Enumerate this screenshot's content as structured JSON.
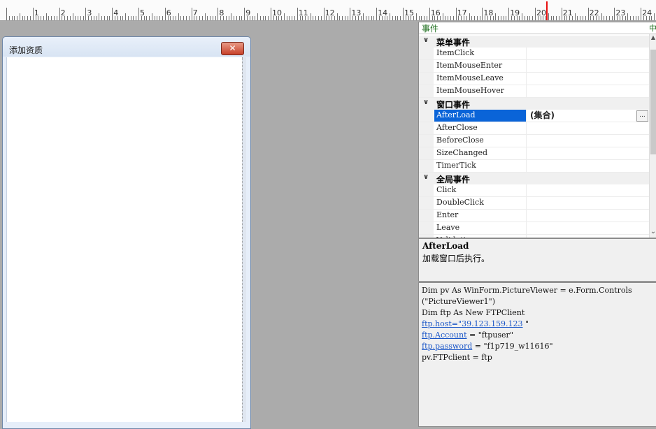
{
  "ruler": {
    "numbers": [
      "1",
      "2",
      "3",
      "4",
      "5",
      "6",
      "7",
      "8",
      "9",
      "10",
      "11",
      "12",
      "13",
      "14",
      "15",
      "16",
      "17",
      "18",
      "19",
      "20",
      "21",
      "22",
      "23",
      "24"
    ]
  },
  "form": {
    "title": "添加资质",
    "close_glyph": "✕"
  },
  "properties": {
    "header": "事件",
    "pin_glyph": "中",
    "categories": [
      {
        "label": "菜单事件",
        "items": [
          {
            "name": "ItemClick",
            "value": ""
          },
          {
            "name": "ItemMouseEnter",
            "value": ""
          },
          {
            "name": "ItemMouseLeave",
            "value": ""
          },
          {
            "name": "ItemMouseHover",
            "value": ""
          }
        ]
      },
      {
        "label": "窗口事件",
        "items": [
          {
            "name": "AfterLoad",
            "value": "(集合)",
            "selected": true,
            "ellipsis": "..."
          },
          {
            "name": "AfterClose",
            "value": ""
          },
          {
            "name": "BeforeClose",
            "value": ""
          },
          {
            "name": "SizeChanged",
            "value": ""
          },
          {
            "name": "TimerTick",
            "value": ""
          }
        ]
      },
      {
        "label": "全局事件",
        "items": [
          {
            "name": "Click",
            "value": ""
          },
          {
            "name": "DoubleClick",
            "value": ""
          },
          {
            "name": "Enter",
            "value": ""
          },
          {
            "name": "Leave",
            "value": ""
          },
          {
            "name": "Validating",
            "value": ""
          }
        ]
      }
    ]
  },
  "description": {
    "title": "AfterLoad",
    "text": "加载窗口后执行。"
  },
  "code": {
    "line1": "Dim pv As WinForm.PictureViewer = e.Form.Controls",
    "line2": "(\"PictureViewer1\")",
    "line3": "Dim ftp As New FTPClient",
    "line4_link": "ftp.host=\"39.123.159.123",
    "line4_rest": " \"",
    "line5_link": "ftp.Account",
    "line5_rest": " = \"ftpuser\"",
    "line6_link": "ftp.password",
    "line6_rest": " = \"f1p719_w11616\"",
    "line7": "pv.FTPclient = ftp"
  }
}
